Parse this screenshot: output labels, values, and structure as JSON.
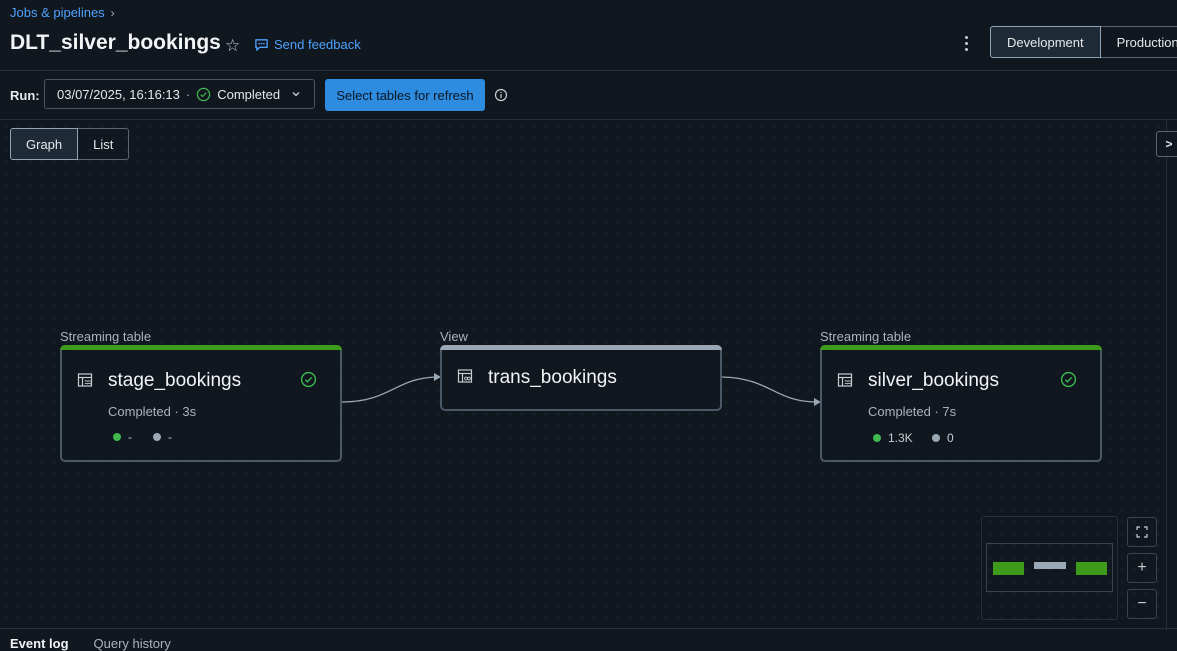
{
  "breadcrumb": {
    "parent": "Jobs & pipelines"
  },
  "header": {
    "title": "DLT_silver_bookings",
    "send_feedback": "Send feedback"
  },
  "modes": {
    "development": "Development",
    "production": "Production"
  },
  "run": {
    "label": "Run:",
    "datetime": "03/07/2025, 16:16:13",
    "separator": "·",
    "status": "Completed",
    "refresh_button": "Select tables for refresh"
  },
  "view_toggle": {
    "graph": "Graph",
    "list": "List"
  },
  "nodes": [
    {
      "type_label": "Streaming table",
      "name": "stage_bookings",
      "status": "Completed · 3s",
      "metric_a": "-",
      "metric_b": "-",
      "bar_color": "#3e9a1a",
      "completed": true
    },
    {
      "type_label": "View",
      "name": "trans_bookings",
      "status": "",
      "metric_a": "",
      "metric_b": "",
      "bar_color": "#9aa7b4",
      "completed": false
    },
    {
      "type_label": "Streaming table",
      "name": "silver_bookings",
      "status": "Completed · 7s",
      "metric_a": "1.3K",
      "metric_b": "0",
      "bar_color": "#3e9a1a",
      "completed": true
    }
  ],
  "colors": {
    "accent": "#2e8ce0",
    "success": "#3e9a1a",
    "link": "#4ea3ff"
  },
  "bottom_tabs": {
    "event_log": "Event log",
    "query_history": "Query history"
  }
}
